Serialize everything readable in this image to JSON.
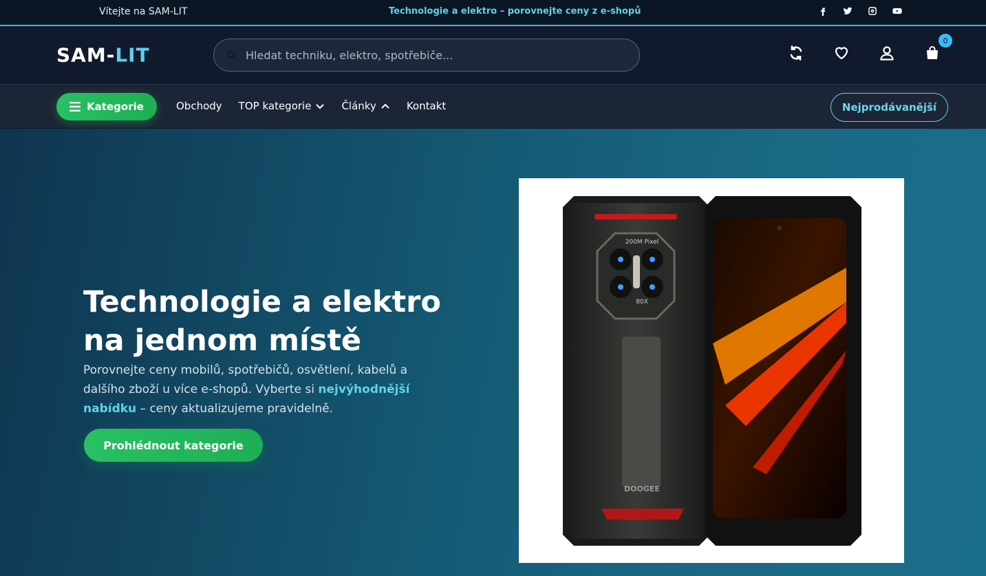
{
  "topbar": {
    "welcome": "Vítejte na SAM-LIT",
    "promo": "Technologie a elektro – porovnejte ceny z e-shopů",
    "social": [
      "facebook-icon",
      "twitter-icon",
      "instagram-icon",
      "youtube-icon"
    ]
  },
  "header": {
    "logo_part1": "SAM-",
    "logo_part2": "LIT",
    "search_placeholder": "Hledat techniku, elektro, spotřebiče...",
    "cart_count": "0",
    "icons": [
      "compare-icon",
      "heart-icon",
      "user-icon",
      "bag-icon"
    ]
  },
  "nav": {
    "categories_label": "Kategorie",
    "links": [
      {
        "label": "Obchody"
      },
      {
        "label": "TOP kategorie"
      },
      {
        "label": "Články"
      },
      {
        "label": "Kontakt"
      }
    ],
    "bestsellers_label": "Nejprodávanější"
  },
  "hero": {
    "title": "Technologie a elektro na jednom místě",
    "desc_part1": "Porovnejte ceny mobilů, spotřebičů, osvětlení, kabelů a dalšího zboží u více e-shopů. Vyberte si ",
    "desc_highlight": "nejvýhodnější nabídku",
    "desc_part2": " – ceny aktualizujeme pravidelně.",
    "cta_label": "Prohlédnout kategorie",
    "product_text_camera": "200M Pixel",
    "product_text_zoom": "80X",
    "product_brand": "DOOGEE"
  },
  "colors": {
    "accent_cyan": "#5fd3e6",
    "accent_green": "#22c55e",
    "header_bg": "#111a2c",
    "nav_bg": "#1c2535"
  }
}
